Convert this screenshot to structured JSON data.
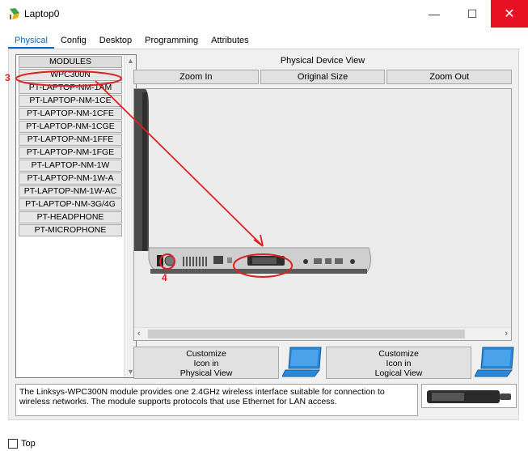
{
  "window": {
    "title": "Laptop0",
    "minimize": "—",
    "maximize": "☐",
    "close": "✕"
  },
  "tabs": [
    {
      "label": "Physical",
      "active": true
    },
    {
      "label": "Config",
      "active": false
    },
    {
      "label": "Desktop",
      "active": false
    },
    {
      "label": "Programming",
      "active": false
    },
    {
      "label": "Attributes",
      "active": false
    }
  ],
  "modules": {
    "header": "MODULES",
    "items": [
      "WPC300N",
      "PT-LAPTOP-NM-1AM",
      "PT-LAPTOP-NM-1CE",
      "PT-LAPTOP-NM-1CFE",
      "PT-LAPTOP-NM-1CGE",
      "PT-LAPTOP-NM-1FFE",
      "PT-LAPTOP-NM-1FGE",
      "PT-LAPTOP-NM-1W",
      "PT-LAPTOP-NM-1W-A",
      "PT-LAPTOP-NM-1W-AC",
      "PT-LAPTOP-NM-3G/4G",
      "PT-HEADPHONE",
      "PT-MICROPHONE"
    ]
  },
  "physical_view": {
    "title": "Physical Device View",
    "zoom_in": "Zoom In",
    "original_size": "Original Size",
    "zoom_out": "Zoom Out"
  },
  "customize": {
    "physical": [
      "Customize",
      "Icon in",
      "Physical View"
    ],
    "logical": [
      "Customize",
      "Icon in",
      "Logical View"
    ]
  },
  "description": "The Linksys-WPC300N module provides one 2.4GHz wireless interface suitable for connection to wireless networks. The module supports protocols that use Ethernet for LAN access.",
  "bottom": {
    "top_label": "Top",
    "top_checked": false
  },
  "annotations": {
    "step3": "3",
    "step4": "4"
  },
  "colors": {
    "accent": "#0a68c8",
    "annotation": "#e02020",
    "close": "#e81123"
  }
}
